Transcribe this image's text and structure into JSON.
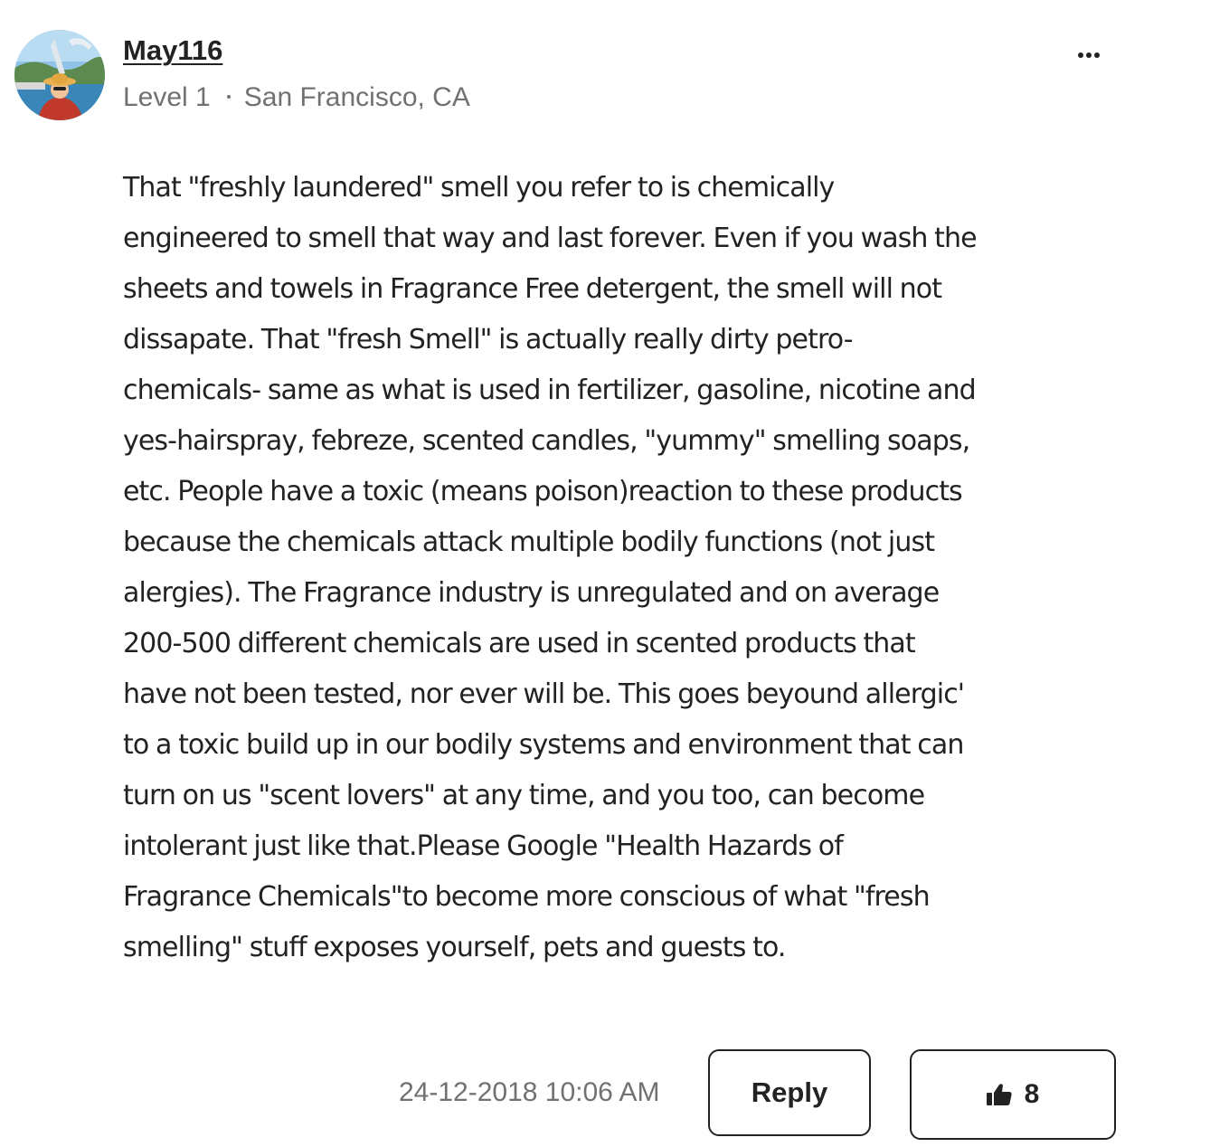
{
  "author": {
    "username": "May116",
    "level": "Level 1",
    "location": "San Francisco, CA",
    "avatar_icon": "user-avatar"
  },
  "menu": {
    "icon": "more-options-icon"
  },
  "post": {
    "lines": [
      "That \"freshly laundered\" smell you refer to is chemically",
      "engineered to smell that way and last forever. Even if you wash the",
      "sheets and towels in Fragrance Free detergent, the smell will not",
      "dissapate. That \"fresh Smell\" is actually really dirty petro-",
      "chemicals- same as what is used in fertilizer, gasoline, nicotine and",
      "yes-hairspray, febreze, scented candles, \"yummy\" smelling soaps,",
      "etc. People have a toxic (means poison)reaction to these products",
      "because the chemicals attack multiple bodily functions (not just",
      "alergies). The Fragrance industry is unregulated and on average",
      "200-500 different chemicals are used in scented products that",
      "have not been tested, nor ever will be. This goes beyound allergic'",
      "to a toxic build up in our bodily systems and environment that can",
      "turn on us \"scent lovers\" at any time, and you too, can become",
      "intolerant just like that.Please Google  \"Health Hazards of",
      "Fragrance Chemicals\"to become more conscious of what \"fresh",
      "smelling\" stuff exposes yourself, pets and guests to."
    ]
  },
  "footer": {
    "timestamp": "24-12-2018 10:06 AM",
    "reply_label": "Reply",
    "like_count": "8",
    "like_icon": "thumbs-up-icon"
  },
  "colors": {
    "text": "#222222",
    "muted": "#717171",
    "border": "#222222",
    "background": "#ffffff"
  }
}
